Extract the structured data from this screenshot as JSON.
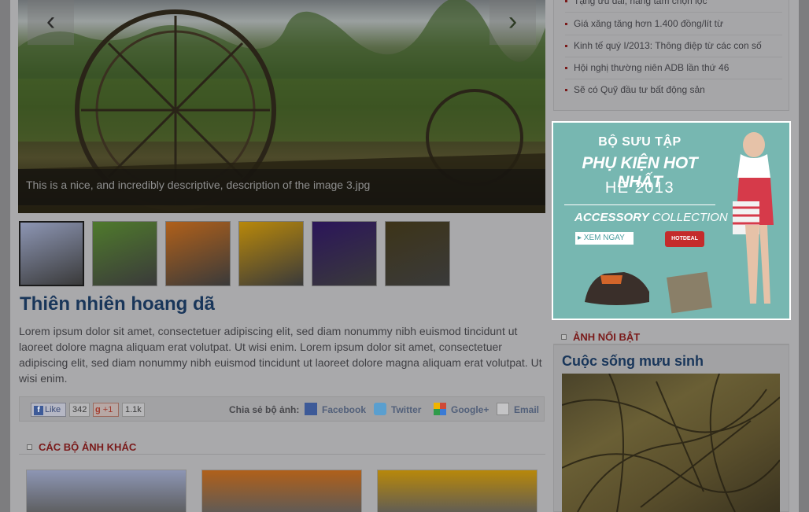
{
  "slideshow": {
    "prev_icon": "chevron-left-icon",
    "next_icon": "chevron-right-icon",
    "prev_glyph": "‹",
    "next_glyph": "›",
    "caption": "This is a nice, and incredibly descriptive, description of the image 3.jpg"
  },
  "thumbnails": [
    {
      "color": "#8d96b4"
    },
    {
      "color": "#4f7a2c"
    },
    {
      "color": "#b0601a"
    },
    {
      "color": "#b8880a"
    },
    {
      "color": "#2b155a"
    },
    {
      "color": "#3d3418"
    }
  ],
  "gallery": {
    "title": "Thiên nhiên hoang dã",
    "description": "Lorem ipsum dolor sit amet, consectetuer adipiscing elit, sed diam nonummy nibh euismod tincidunt ut laoreet dolore magna aliquam erat volutpat. Ut wisi enim. Lorem ipsum dolor sit amet, consectetuer adipiscing elit, sed diam nonummy nibh euismod tincidunt ut laoreet dolore magna aliquam erat volutpat. Ut wisi enim."
  },
  "share": {
    "like_label": "Like",
    "like_count": "342",
    "gplus_label": "+1",
    "gplus_count": "1.1k",
    "share_label": "Chia sẻ bộ ảnh:",
    "links": {
      "facebook": "Facebook",
      "twitter": "Twitter",
      "googleplus": "Google+",
      "email": "Email"
    }
  },
  "other_albums": {
    "heading": "CÁC BỘ ẢNH KHÁC",
    "items": [
      {
        "color": "#8d96b4"
      },
      {
        "color": "#b0601a"
      },
      {
        "color": "#b8880a"
      }
    ]
  },
  "news": [
    "Tặng ưu đãi, hàng tấm chọn lọc",
    "Giá xăng tăng hơn 1.400 đồng/lít từ",
    "Kinh tế quý I/2013: Thông điệp từ các con số",
    "Hội nghị thường niên ADB lần thứ 46",
    "Sẽ có Quỹ đầu tư bất động sản"
  ],
  "ad": {
    "line1": "BỘ SƯU TẬP",
    "line2": "PHỤ KIỆN HOT NHẤT",
    "line3": "HÈ 2013",
    "collection_bold": "ACCESSORY",
    "collection_rest": " COLLECTION",
    "cta": "▸ XEM NGAY",
    "badge": "HOTDEAL"
  },
  "featured": {
    "heading": "ẢNH NỔI BẬT",
    "title": "Cuộc sống mưu sinh"
  }
}
